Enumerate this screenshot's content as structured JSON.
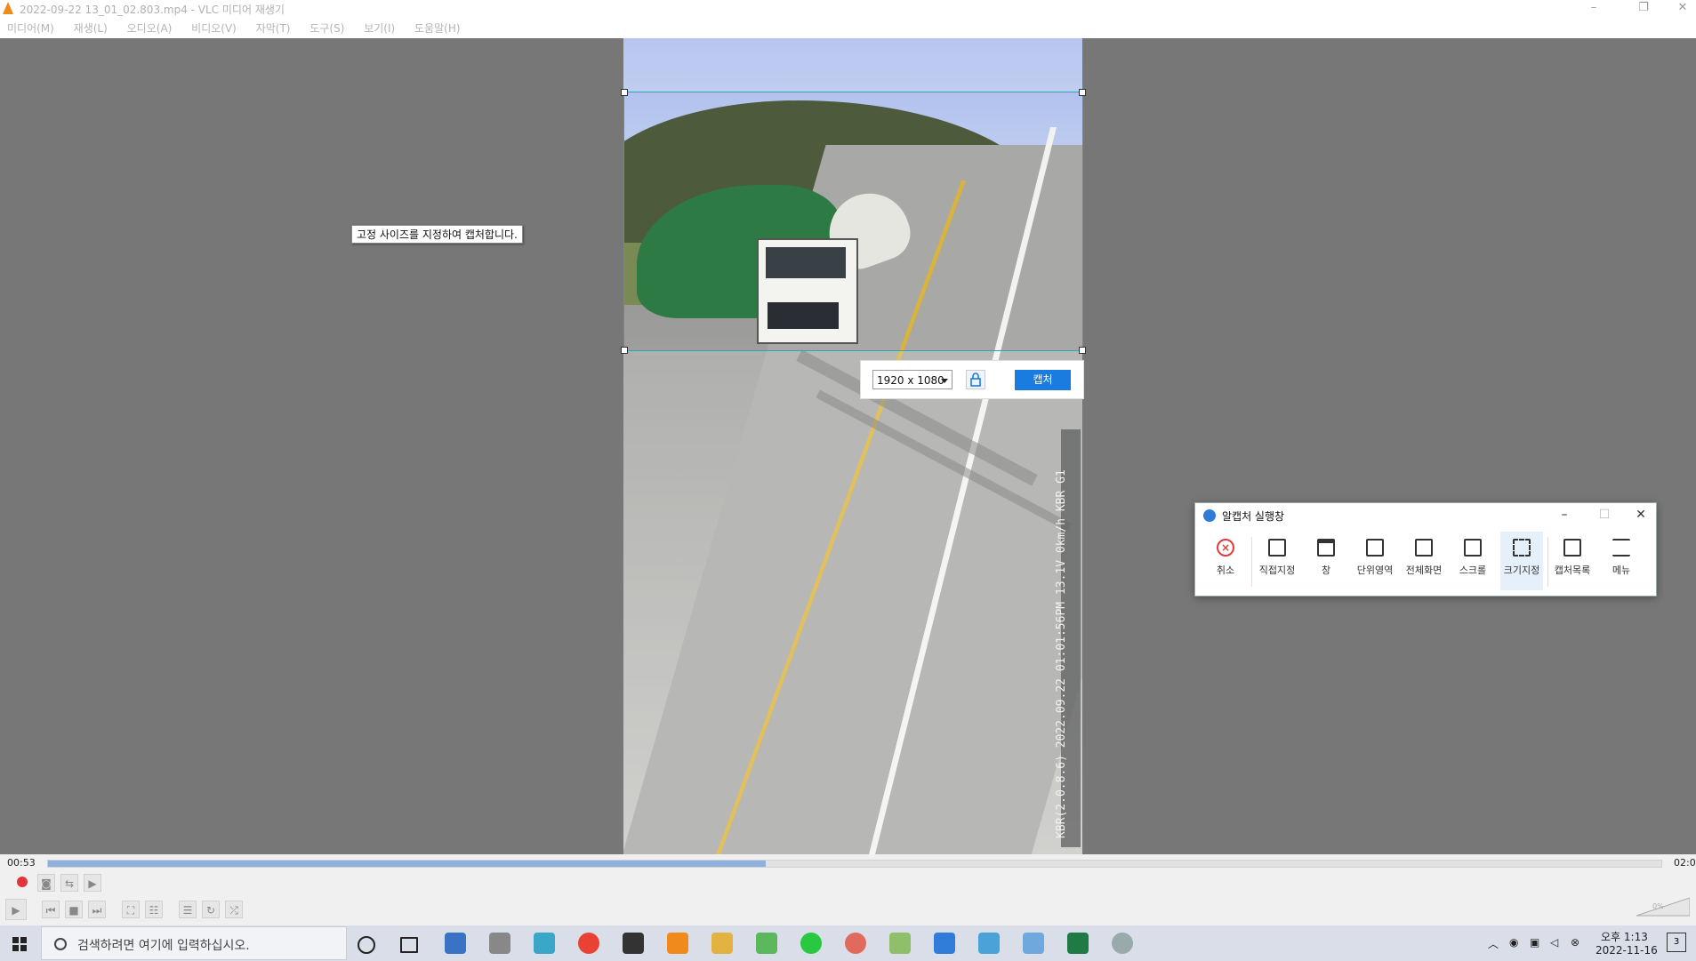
{
  "window": {
    "title": "2022-09-22 13_01_02.803.mp4 - VLC 미디어 재생기",
    "minimize": "–",
    "restore": "❐",
    "close": "✕"
  },
  "menu": [
    "미디어(M)",
    "재생(L)",
    "오디오(A)",
    "비디오(V)",
    "자막(T)",
    "도구(S)",
    "보기(I)",
    "도움말(H)"
  ],
  "video": {
    "osd_text": "KBR(2.0.8.6) 2022.09.22 01:01:56PM 13.1V  0km/h KBR G1"
  },
  "capture": {
    "tooltip": "고정 사이즈를 지정하여 캡처합니다.",
    "size_value": "1920 x 1080",
    "capture_button": "캡처"
  },
  "player": {
    "time_elapsed": "00:53",
    "time_total": "02:0",
    "progress_fraction": 0.445,
    "volume_percent": "0%"
  },
  "panel": {
    "title": "알캡처 실행창",
    "minimize": "–",
    "maximize": "☐",
    "close": "✕",
    "tools": [
      {
        "label": "취소"
      },
      {
        "label": "직접지정"
      },
      {
        "label": "창"
      },
      {
        "label": "단위영역"
      },
      {
        "label": "전체화면"
      },
      {
        "label": "스크롤"
      },
      {
        "label": "크기지정"
      },
      {
        "label": "캡처목록"
      },
      {
        "label": "메뉴"
      }
    ]
  },
  "taskbar": {
    "search_placeholder": "검색하려면 여기에 입력하십시오.",
    "clock_time": "오후 1:13",
    "clock_date": "2022-11-16",
    "notification_count": "3"
  },
  "colors": {
    "capture_blue": "#1a7be0",
    "selection_border": "#2aa7b5",
    "record_red": "#e3343b"
  }
}
